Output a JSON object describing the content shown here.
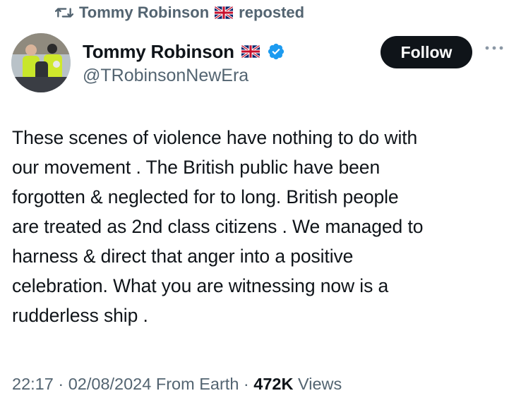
{
  "repost": {
    "name": "Tommy Robinson",
    "flag_icon": "uk-flag-icon",
    "label": "reposted"
  },
  "author": {
    "display_name": "Tommy Robinson",
    "flag_icon": "uk-flag-icon",
    "verified_icon": "verified-badge-icon",
    "handle": "@TRobinsonNewEra"
  },
  "follow_label": "Follow",
  "more_icon": "more-options-icon",
  "tweet": {
    "text": "These scenes of violence have nothing to do with\nour movement . The British public have been\nforgotten & neglected for to long. British people\nare treated as 2nd class citizens . We managed to\nharness & direct that anger into a positive\ncelebration. What you are witnessing now is a\nrudderless ship ."
  },
  "meta": {
    "time": "22:17",
    "separator": "·",
    "date": "02/08/2024",
    "location": "From Earth",
    "views_count": "472K",
    "views_label": "Views"
  },
  "colors": {
    "text_primary": "#0f1419",
    "text_secondary": "#536471",
    "verified_blue": "#1d9bf0",
    "follow_bg": "#0f1419"
  }
}
